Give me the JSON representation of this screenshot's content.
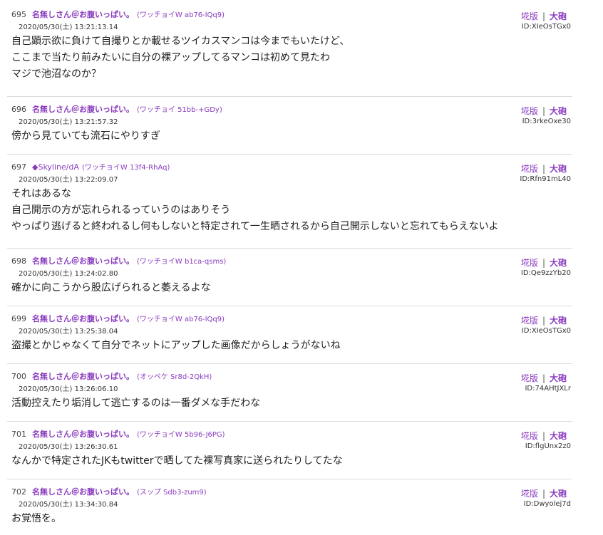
{
  "labels": {
    "board": "埖版",
    "sep": "|",
    "cannon": "大砲"
  },
  "posts": [
    {
      "num": "695",
      "name": "名無しさん＠お腹いっぱい。",
      "wacchoi": "(ワッチョイW ab76-lQq9)",
      "date": "2020/05/30(土) 13:21:13.14",
      "id": "ID:XIeOsTGx0",
      "lines": [
        "自己顕示欲に負けて自撮りとか載せるツイカスマンコは今までもいたけど、",
        "ここまで当たり前みたいに自分の裸アップしてるマンコは初めて見たわ",
        "マジで池沼なのか？"
      ]
    },
    {
      "num": "696",
      "name": "名無しさん＠お腹いっぱい。",
      "wacchoi": "(ワッチョイ 51bb-+GDy)",
      "date": "2020/05/30(土) 13:21:57.32",
      "id": "ID:3rkeOxe30",
      "lines": [
        "傍から見ていても流石にやりすぎ"
      ]
    },
    {
      "num": "697",
      "name": "◆Skyline/dA",
      "wacchoi": "(ワッチョイW 13f4-RhAq)",
      "date": "2020/05/30(土) 13:22:09.07",
      "id": "ID:Rfn91mL40",
      "lines": [
        "それはあるな",
        "自己開示の方が忘れられるっていうのはありそう",
        "やっぱり逃げると終われるし何もしないと特定されて一生晒されるから自己開示しないと忘れてもらえないよ"
      ]
    },
    {
      "num": "698",
      "name": "名無しさん＠お腹いっぱい。",
      "wacchoi": "(ワッチョイW b1ca-qsms)",
      "date": "2020/05/30(土) 13:24:02.80",
      "id": "ID:Qe9zzYb20",
      "lines": [
        "確かに向こうから股広げられると萎えるよな"
      ]
    },
    {
      "num": "699",
      "name": "名無しさん＠お腹いっぱい。",
      "wacchoi": "(ワッチョイW ab76-lQq9)",
      "date": "2020/05/30(土) 13:25:38.04",
      "id": "ID:XIeOsTGx0",
      "lines": [
        "盗撮とかじゃなくて自分でネットにアップした画像だからしょうがないね"
      ]
    },
    {
      "num": "700",
      "name": "名無しさん＠お腹いっぱい。",
      "wacchoi": "(オッペケ Sr8d-2QkH)",
      "date": "2020/05/30(土) 13:26:06.10",
      "id": "ID:74AHtJXLr",
      "lines": [
        "活動控えたり垢消して逃亡するのは一番ダメな手だわな"
      ]
    },
    {
      "num": "701",
      "name": "名無しさん＠お腹いっぱい。",
      "wacchoi": "(ワッチョイW 5b96-J6PG)",
      "date": "2020/05/30(土) 13:26:30.61",
      "id": "ID:flgUnx2z0",
      "lines": [
        "なんかで特定されたJKもtwitterで晒してた裸写真家に送られたりしてたな"
      ]
    },
    {
      "num": "702",
      "name": "名無しさん＠お腹いっぱい。",
      "wacchoi": "(スップ Sdb3-zum9)",
      "date": "2020/05/30(土) 13:34:30.84",
      "id": "ID:Dwyolej7d",
      "lines": [
        "お覚悟を。"
      ]
    }
  ]
}
